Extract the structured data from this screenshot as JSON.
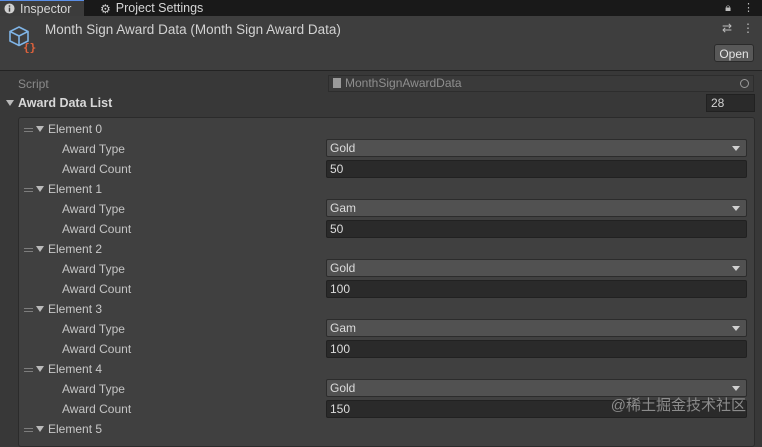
{
  "tabs": [
    {
      "label": "Inspector",
      "icon": "info-icon",
      "active": true
    },
    {
      "label": "Project Settings",
      "icon": "gear-icon",
      "active": false
    }
  ],
  "header": {
    "title": "Month Sign Award Data (Month Sign Award Data)",
    "open_label": "Open"
  },
  "script": {
    "label": "Script",
    "value": "MonthSignAwardData"
  },
  "list": {
    "label": "Award Data List",
    "size": "28"
  },
  "elements": [
    {
      "name": "Element 0",
      "type_label": "Award Type",
      "type_value": "Gold",
      "count_label": "Award Count",
      "count_value": "50"
    },
    {
      "name": "Element 1",
      "type_label": "Award Type",
      "type_value": "Gam",
      "count_label": "Award Count",
      "count_value": "50"
    },
    {
      "name": "Element 2",
      "type_label": "Award Type",
      "type_value": "Gold",
      "count_label": "Award Count",
      "count_value": "100"
    },
    {
      "name": "Element 3",
      "type_label": "Award Type",
      "type_value": "Gam",
      "count_label": "Award Count",
      "count_value": "100"
    },
    {
      "name": "Element 4",
      "type_label": "Award Type",
      "type_value": "Gold",
      "count_label": "Award Count",
      "count_value": "150"
    },
    {
      "name": "Element 5"
    }
  ],
  "watermark": "@稀土掘金技术社区",
  "colors": {
    "accent": "#5a8ee6",
    "background": "#383838",
    "tabbar": "#191919"
  }
}
